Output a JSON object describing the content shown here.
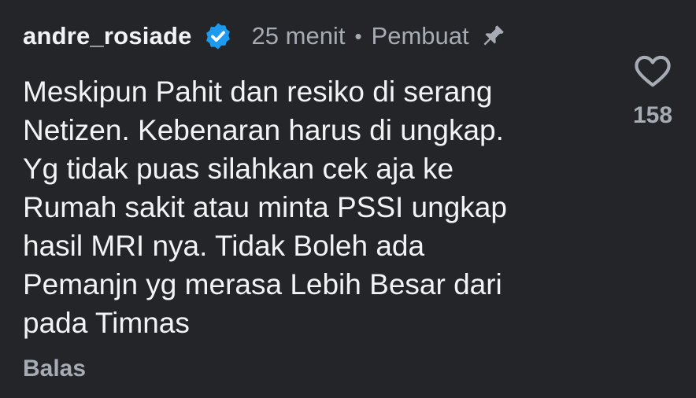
{
  "comment": {
    "username": "andre_rosiade",
    "verified_icon": "verified-badge-icon",
    "time": "25 menit",
    "separator": "•",
    "creator_label": "Pembuat",
    "pin_icon": "pin-icon",
    "text": "Meskipun Pahit dan resiko di serang\nNetizen. Kebenaran harus di ungkap.\nYg tidak puas silahkan cek aja ke\nRumah sakit atau minta PSSI ungkap\nhasil MRI nya. Tidak Boleh  ada\nPemanjn yg merasa Lebih Besar dari\npada Timnas",
    "reply_label": "Balas",
    "like_icon": "heart-icon",
    "like_count": "158"
  },
  "colors": {
    "background": "#232529",
    "primary_text": "#f2f3f5",
    "secondary_text": "#a7acb4",
    "verified_blue": "#1d9bf0"
  }
}
